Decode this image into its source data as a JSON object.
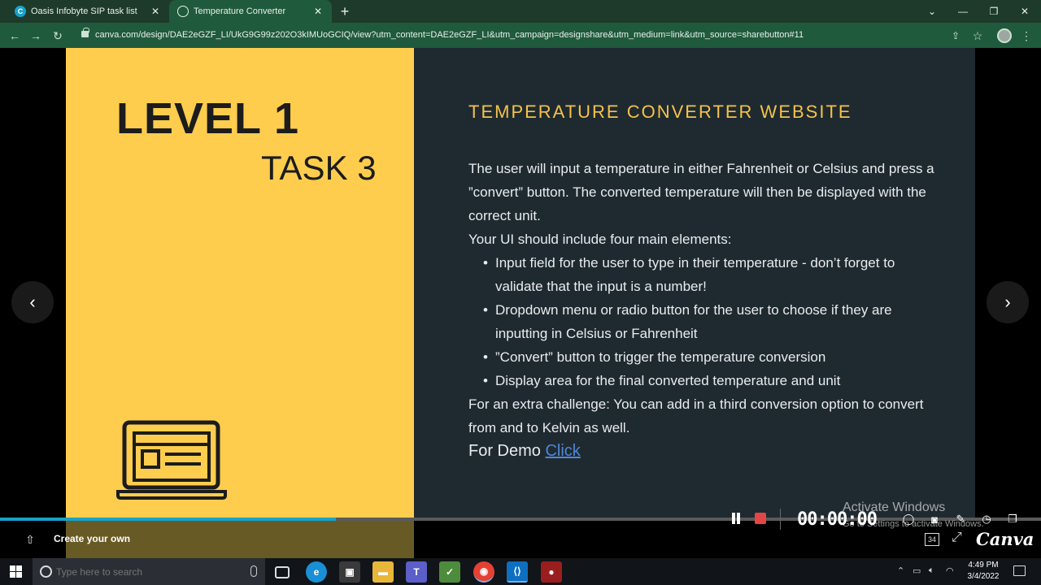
{
  "browser": {
    "tabs": [
      {
        "label": "Oasis Infobyte SIP task list",
        "favicon": "C"
      },
      {
        "label": "Temperature Converter",
        "favicon": "globe-icon",
        "active": true
      }
    ],
    "url": "canva.com/design/DAE2eGZF_LI/UkG9G99z202O3kIMUoGCIQ/view?utm_content=DAE2eGZF_LI&utm_campaign=designshare&utm_medium=link&utm_source=sharebutton#11"
  },
  "slide": {
    "level": "LEVEL 1",
    "task": "TASK 3",
    "title": "TEMPERATURE CONVERTER WEBSITE",
    "intro": "The user will input a temperature in either Fahrenheit or Celsius and press a ”convert” button. The converted temperature will then be displayed with the correct unit.",
    "ui_line": "Your UI should include four main elements:",
    "bullets": [
      "Input field for the user to type in their temperature - don’t forget to validate that the input is a number!",
      "Dropdown menu or radio button for the user to choose if they are inputting in Celsius or Fahrenheit",
      "”Convert” button to trigger the temperature conversion",
      "Display area for the final converted temperature and unit"
    ],
    "challenge": "For an extra challenge: You can add in a third conversion option to convert from and to Kelvin as well.",
    "demo_label": "For Demo",
    "demo_link": "Click"
  },
  "viewer": {
    "progress": 0.323,
    "create_label": "Create your own",
    "page_badge": "34",
    "brand": "Canva"
  },
  "recorder": {
    "timer": "00:00:00"
  },
  "watermark": {
    "title": "Activate Windows",
    "subtitle": "Go to Settings to activate Windows."
  },
  "taskbar": {
    "search_placeholder": "Type here to search",
    "time": "4:49 PM",
    "date": "3/4/2022"
  },
  "colors": {
    "slide_yellow": "#fecd4e",
    "slide_dark": "#1f2a30",
    "title_accent": "#f6c24a",
    "progress": "#19a1c9",
    "link": "#4f86d8"
  }
}
